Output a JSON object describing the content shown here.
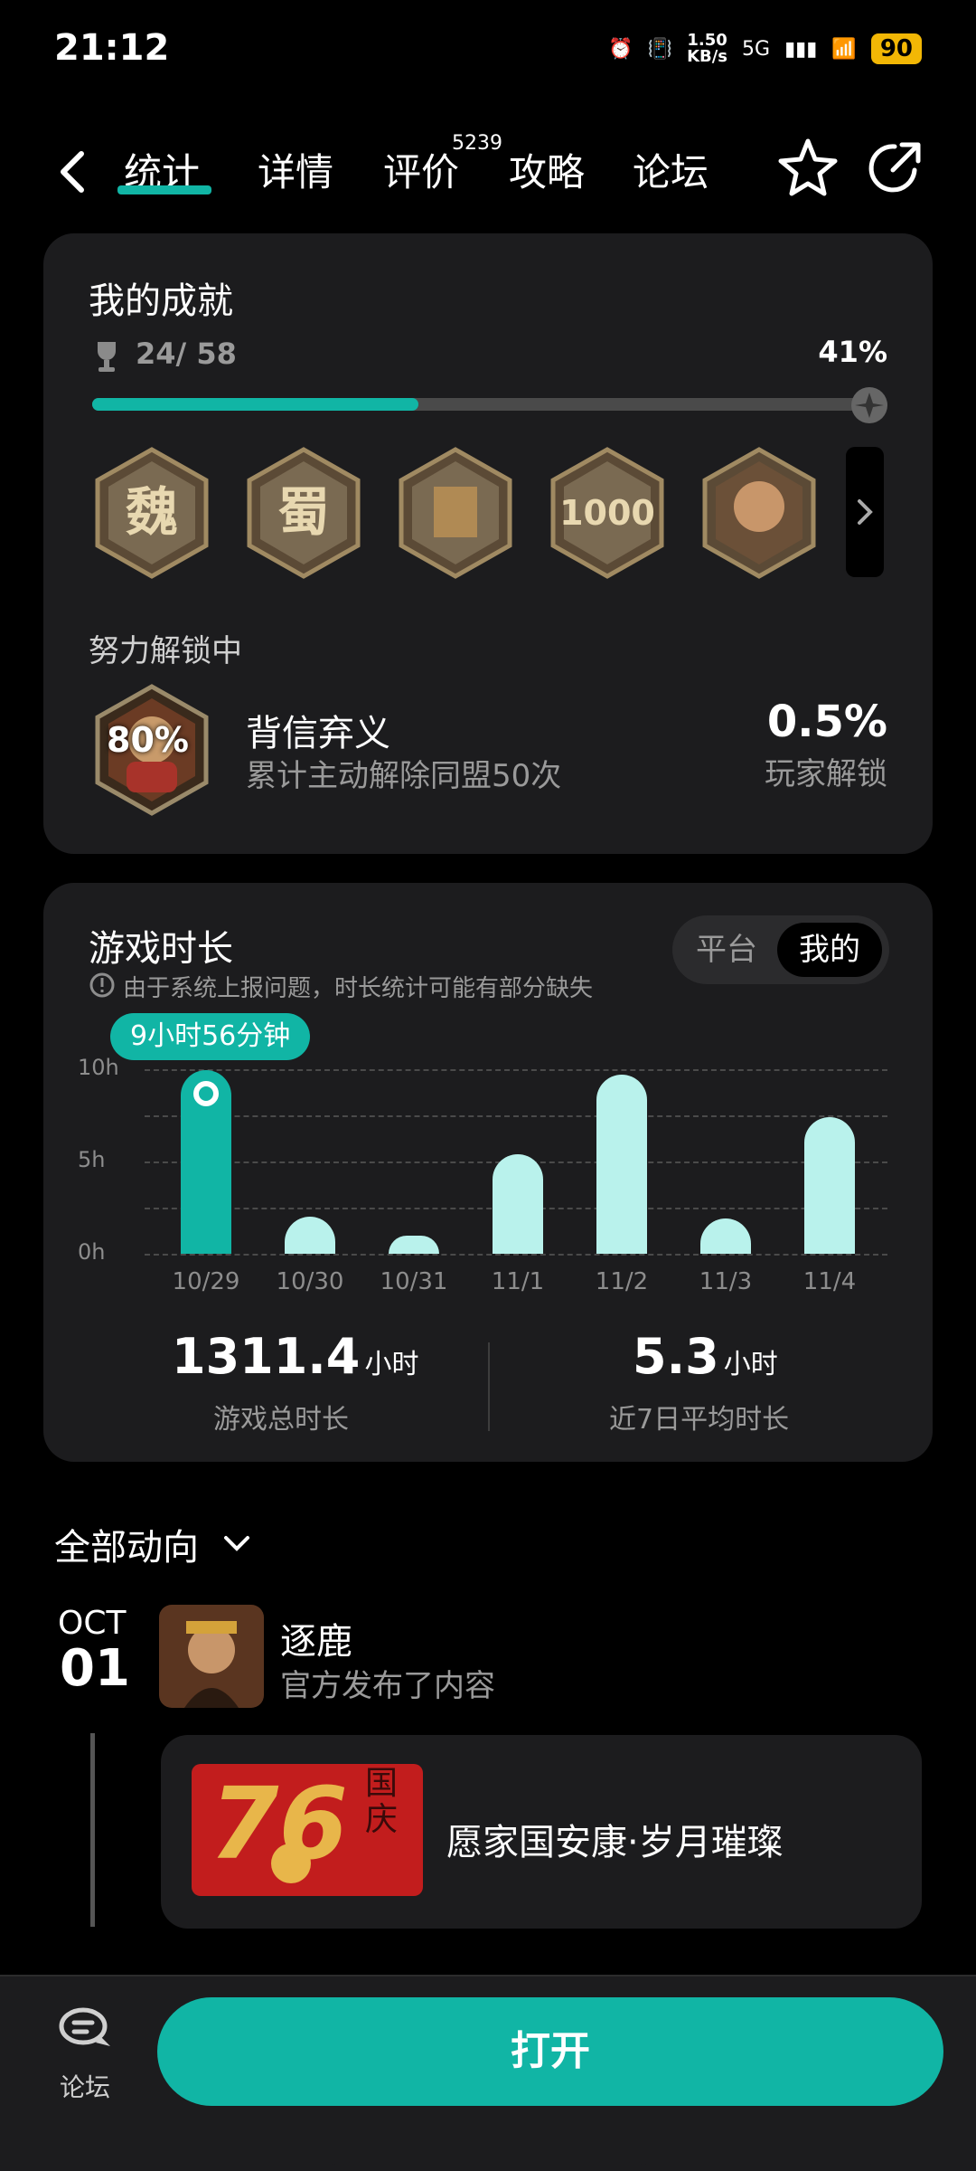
{
  "status": {
    "time": "21:12",
    "speed_value": "1.50",
    "speed_unit": "KB/s",
    "network": "5G",
    "battery": "90"
  },
  "nav": {
    "tabs": [
      "统计",
      "详情",
      "评价",
      "攻略",
      "论坛"
    ],
    "review_count": "5239",
    "active_tab": "统计"
  },
  "achievements": {
    "title": "我的成就",
    "progress_text": "24/ 58",
    "percent_text": "41%",
    "progress": 0.41,
    "badges": [
      "魏",
      "蜀",
      "tower-badge",
      "1000",
      "warrior-badge"
    ],
    "unlocking_title": "努力解锁中",
    "item": {
      "progress": "80%",
      "name": "背信弃义",
      "desc": "累计主动解除同盟50次",
      "rate": "0.5%",
      "rate_label": "玩家解锁"
    }
  },
  "playtime": {
    "title": "游戏时长",
    "note": "由于系统上报问题，时长统计可能有部分缺失",
    "toggle": [
      "平台",
      "我的"
    ],
    "tooltip": "9小时56分钟",
    "yticks": [
      "10h",
      "5h",
      "0h"
    ],
    "total_value": "1311.4",
    "total_unit": "小时",
    "total_label": "游戏总时长",
    "avg_value": "5.3",
    "avg_unit": "小时",
    "avg_label": "近7日平均时长"
  },
  "chart_data": {
    "type": "bar",
    "categories": [
      "10/29",
      "10/30",
      "10/31",
      "11/1",
      "11/2",
      "11/3",
      "11/4"
    ],
    "values": [
      9.93,
      2.0,
      1.0,
      5.4,
      9.7,
      1.9,
      7.4
    ],
    "ylim": [
      0,
      10
    ],
    "highlight_index": 0,
    "colors": {
      "highlight": "#11b5a5",
      "normal": "#b9f2ec"
    }
  },
  "feed": {
    "title": "全部动向",
    "date_month": "OCT",
    "date_day": "01",
    "author": "逐鹿",
    "action": "官方发布了内容",
    "post_title": "愿家国安康·岁月璀璨",
    "thumb_label": "76",
    "thumb_text": "国庆"
  },
  "footer": {
    "forum_label": "论坛",
    "open_label": "打开"
  }
}
